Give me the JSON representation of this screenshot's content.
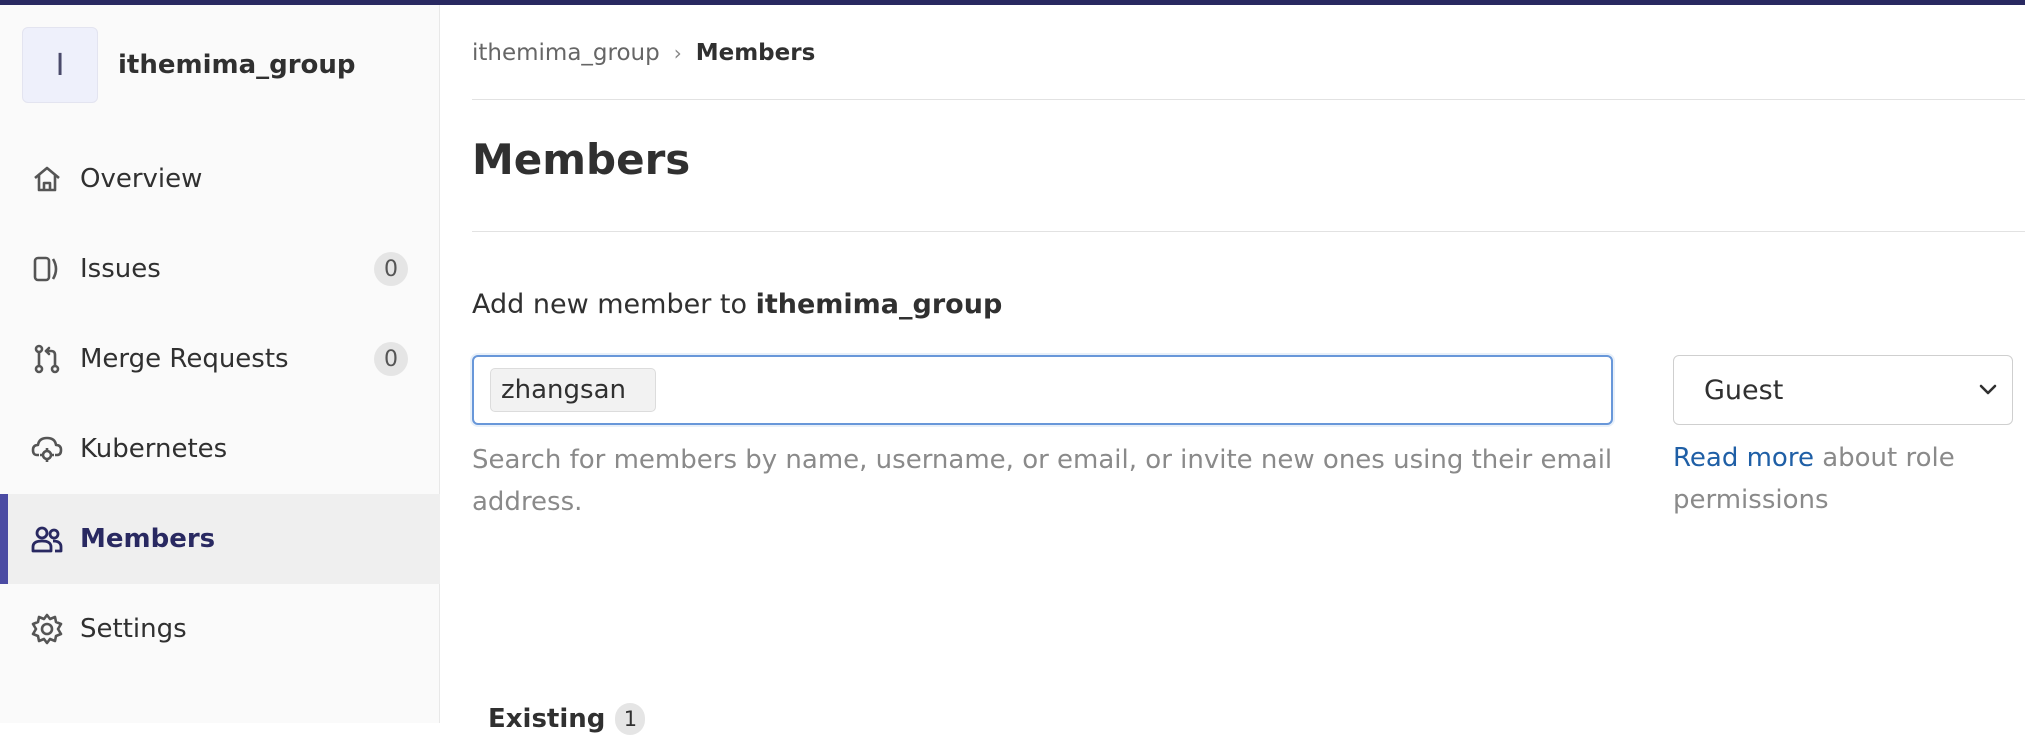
{
  "group": {
    "avatar_letter": "I",
    "name": "ithemima_group"
  },
  "sidebar": {
    "items": [
      {
        "label": "Overview",
        "icon": "home-icon"
      },
      {
        "label": "Issues",
        "icon": "issues-icon",
        "count": "0"
      },
      {
        "label": "Merge Requests",
        "icon": "merge-request-icon",
        "count": "0"
      },
      {
        "label": "Kubernetes",
        "icon": "cloud-gear-icon"
      },
      {
        "label": "Members",
        "icon": "users-icon",
        "active": true
      },
      {
        "label": "Settings",
        "icon": "gear-icon"
      }
    ]
  },
  "breadcrumb": {
    "parent": "ithemima_group",
    "separator": "›",
    "current": "Members"
  },
  "page": {
    "title": "Members"
  },
  "add_member": {
    "heading_prefix": "Add new member to ",
    "heading_group": "ithemima_group",
    "token_value": "zhangsan",
    "help_text": "Search for members by name, username, or email, or invite new ones using their email address.",
    "role_value": "Guest",
    "role_help_link": "Read more",
    "role_help_rest": " about role permissions"
  },
  "tabs": {
    "existing_label": "Existing",
    "existing_count": "1"
  },
  "colors": {
    "accent": "#4b4ba3",
    "topbar": "#292961",
    "link": "#1f5fa6",
    "input_focus": "#6897d9"
  }
}
